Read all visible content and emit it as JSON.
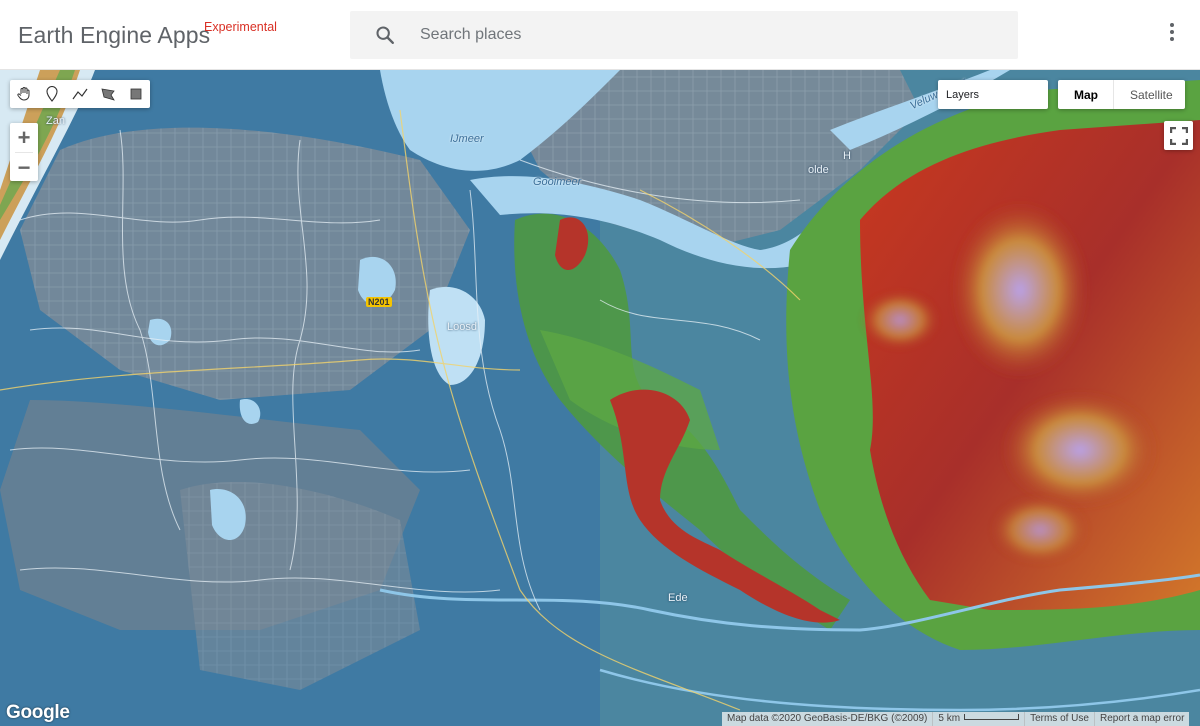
{
  "header": {
    "title": "Earth Engine Apps",
    "tag": "Experimental",
    "search_placeholder": "Search places"
  },
  "map": {
    "layers_label": "Layers",
    "map_types": [
      "Map",
      "Satellite"
    ],
    "active_map_type": "Map",
    "zoom_in": "+",
    "zoom_out": "−",
    "logo": "Google",
    "attribution": {
      "data": "Map data ©2020 GeoBasis-DE/BKG (©2009)",
      "scale": "5 km",
      "terms": "Terms of Use",
      "report": "Report a map error"
    },
    "labels": {
      "ijmeer": "IJmeer",
      "gooimeer": "Gooimeer",
      "veluwemeer": "Veluwemeer",
      "zandvoort": "Zan",
      "loosdrecht": "Loosd",
      "harderwijk": "H",
      "zeewolde": "olde",
      "ede": "Ede",
      "road": "N201"
    },
    "icons": [
      "hand-icon",
      "marker-icon",
      "line-icon",
      "polygon-icon",
      "rectangle-icon",
      "fullscreen-icon",
      "search-icon",
      "more-vert-icon"
    ]
  },
  "colors": {
    "water": "#a8d4ef",
    "lowland": "#3f7aa3",
    "urban": "#7f8d9a",
    "forest": "#4f9a3c",
    "hills": "#b8342a",
    "highest": "#9f87d6",
    "accent_red": "#d93025"
  }
}
